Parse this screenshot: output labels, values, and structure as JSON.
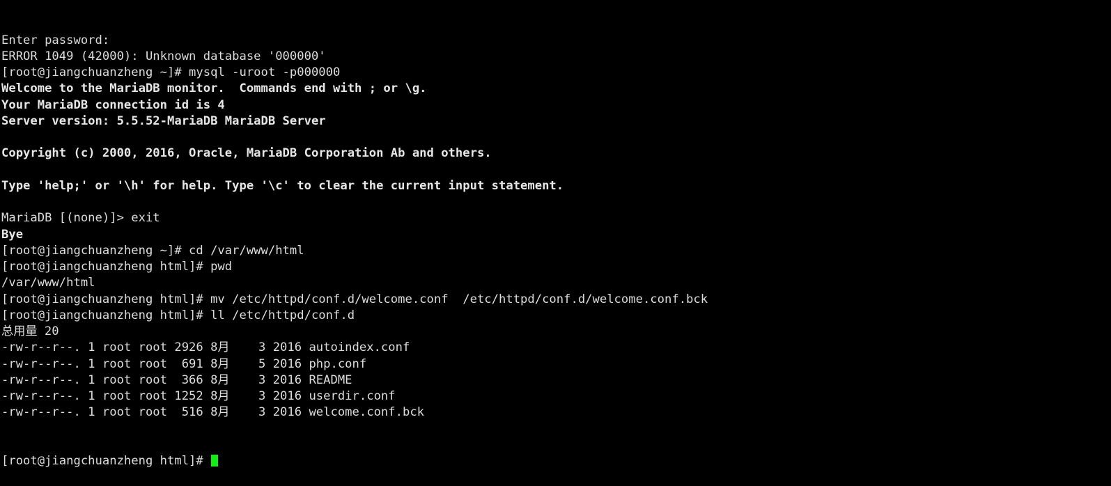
{
  "terminal": {
    "background_color": "#000000",
    "foreground_color": "#dcdcdc",
    "cursor_color": "#12ef12",
    "hostname": "jiangchuanzheng",
    "user": "root",
    "lines": [
      {
        "id": "l01",
        "text": "Enter password:",
        "bold": false
      },
      {
        "id": "l02",
        "text": "ERROR 1049 (42000): Unknown database '000000'",
        "bold": false
      },
      {
        "id": "l03",
        "text": "[root@jiangchuanzheng ~]# mysql -uroot -p000000",
        "bold": false
      },
      {
        "id": "l04",
        "text": "Welcome to the MariaDB monitor.  Commands end with ; or \\g.",
        "bold": true
      },
      {
        "id": "l05",
        "text": "Your MariaDB connection id is 4",
        "bold": true
      },
      {
        "id": "l06",
        "text": "Server version: 5.5.52-MariaDB MariaDB Server",
        "bold": true
      },
      {
        "id": "l07",
        "text": "",
        "bold": false
      },
      {
        "id": "l08",
        "text": "Copyright (c) 2000, 2016, Oracle, MariaDB Corporation Ab and others.",
        "bold": true
      },
      {
        "id": "l09",
        "text": "",
        "bold": false
      },
      {
        "id": "l10",
        "text": "Type 'help;' or '\\h' for help. Type '\\c' to clear the current input statement.",
        "bold": true
      },
      {
        "id": "l11",
        "text": "",
        "bold": false
      },
      {
        "id": "l12",
        "text": "MariaDB [(none)]> exit",
        "bold": false
      },
      {
        "id": "l13",
        "text": "Bye",
        "bold": true
      },
      {
        "id": "l14",
        "text": "[root@jiangchuanzheng ~]# cd /var/www/html",
        "bold": false
      },
      {
        "id": "l15",
        "text": "[root@jiangchuanzheng html]# pwd",
        "bold": false
      },
      {
        "id": "l16",
        "text": "/var/www/html",
        "bold": false
      },
      {
        "id": "l17",
        "text": "[root@jiangchuanzheng html]# mv /etc/httpd/conf.d/welcome.conf  /etc/httpd/conf.d/welcome.conf.bck",
        "bold": false
      },
      {
        "id": "l18",
        "text": "[root@jiangchuanzheng html]# ll /etc/httpd/conf.d",
        "bold": false
      },
      {
        "id": "l19",
        "text": "总用量 20",
        "bold": false
      },
      {
        "id": "l20",
        "text": "-rw-r--r--. 1 root root 2926 8月    3 2016 autoindex.conf",
        "bold": false
      },
      {
        "id": "l21",
        "text": "-rw-r--r--. 1 root root  691 8月    5 2016 php.conf",
        "bold": false
      },
      {
        "id": "l22",
        "text": "-rw-r--r--. 1 root root  366 8月    3 2016 README",
        "bold": false
      },
      {
        "id": "l23",
        "text": "-rw-r--r--. 1 root root 1252 8月    3 2016 userdir.conf",
        "bold": false
      },
      {
        "id": "l24",
        "text": "-rw-r--r--. 1 root root  516 8月    3 2016 welcome.conf.bck",
        "bold": false
      }
    ],
    "prompt": {
      "text": "[root@jiangchuanzheng html]# ",
      "cursor_visible": true
    },
    "listing": {
      "total_label": "总用量",
      "total_blocks": "20",
      "columns": [
        "permissions",
        "links",
        "owner",
        "group",
        "size",
        "month",
        "day",
        "year",
        "name"
      ],
      "entries": [
        {
          "permissions": "-rw-r--r--.",
          "links": "1",
          "owner": "root",
          "group": "root",
          "size": "2926",
          "month": "8月",
          "day": "3",
          "year": "2016",
          "name": "autoindex.conf"
        },
        {
          "permissions": "-rw-r--r--.",
          "links": "1",
          "owner": "root",
          "group": "root",
          "size": "691",
          "month": "8月",
          "day": "5",
          "year": "2016",
          "name": "php.conf"
        },
        {
          "permissions": "-rw-r--r--.",
          "links": "1",
          "owner": "root",
          "group": "root",
          "size": "366",
          "month": "8月",
          "day": "3",
          "year": "2016",
          "name": "README"
        },
        {
          "permissions": "-rw-r--r--.",
          "links": "1",
          "owner": "root",
          "group": "root",
          "size": "1252",
          "month": "8月",
          "day": "3",
          "year": "2016",
          "name": "userdir.conf"
        },
        {
          "permissions": "-rw-r--r--.",
          "links": "1",
          "owner": "root",
          "group": "root",
          "size": "516",
          "month": "8月",
          "day": "3",
          "year": "2016",
          "name": "welcome.conf.bck"
        }
      ]
    },
    "session": {
      "db_error_code": "1049",
      "db_sqlstate": "42000",
      "db_error_message": "Unknown database '000000'",
      "mysql_command": "mysql -uroot -p000000",
      "server_version": "5.5.52-MariaDB MariaDB Server",
      "connection_id": "4",
      "copyright": "Copyright (c) 2000, 2016, Oracle, MariaDB Corporation Ab and others.",
      "working_directory": "/var/www/html"
    }
  }
}
